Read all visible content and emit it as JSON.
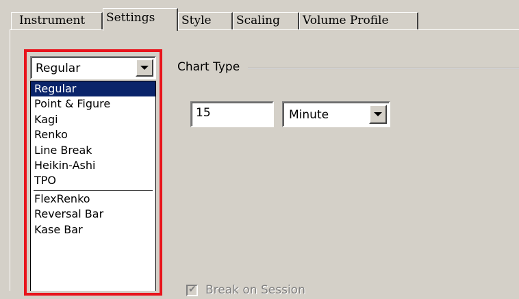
{
  "tabs": [
    {
      "label": "Instrument",
      "active": false
    },
    {
      "label": "Settings",
      "active": true
    },
    {
      "label": "Style",
      "active": false
    },
    {
      "label": "Scaling",
      "active": false
    },
    {
      "label": "Volume Profile",
      "active": false
    }
  ],
  "chart_type": {
    "group_title": "Chart Type",
    "selected": "Regular",
    "options": [
      "Regular",
      "Point & Figure",
      "Kagi",
      "Renko",
      "Line Break",
      "Heikin-Ashi",
      "TPO",
      "FlexRenko",
      "Reversal Bar",
      "Kase Bar"
    ],
    "separator_after_index": 6
  },
  "interval": {
    "value": "15",
    "unit": "Minute"
  },
  "break_on_session": {
    "label": "Break on Session",
    "checked": true,
    "enabled": false
  },
  "colors": {
    "highlight_frame": "#e8141c",
    "selection": "#0a246a",
    "window_bg": "#d4d0c8"
  }
}
